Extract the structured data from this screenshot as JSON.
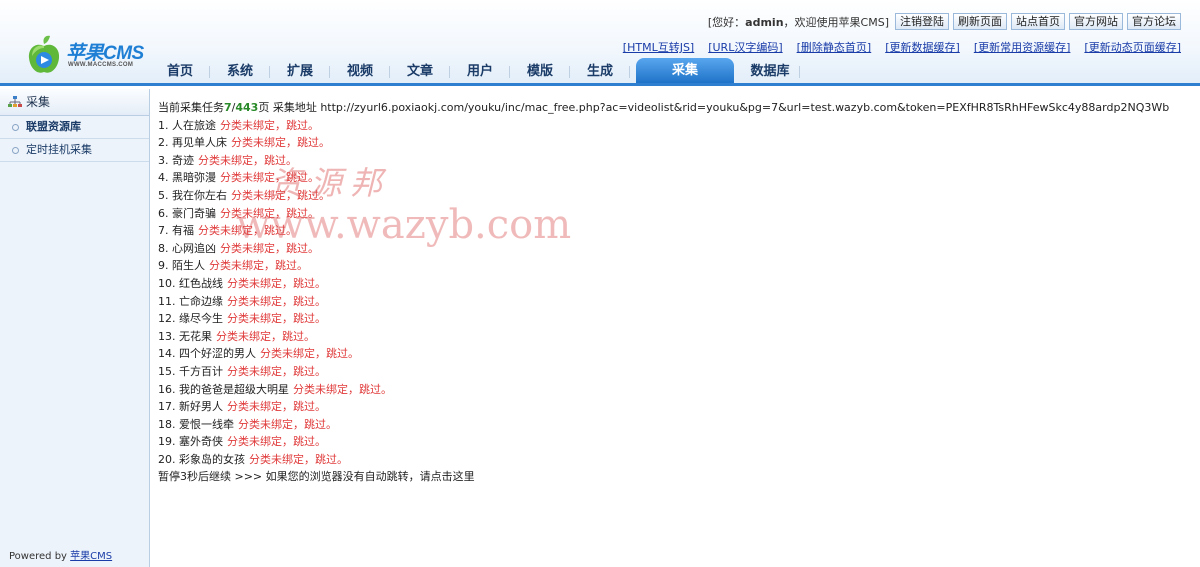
{
  "header": {
    "logo_text": "苹果CMS",
    "logo_sub": "WWW.MACCMS.COM",
    "welcome_prefix": "[您好：",
    "username": "admin",
    "welcome_suffix": "，欢迎使用苹果CMS]",
    "buttons": [
      "注销登陆",
      "刷新页面",
      "站点首页",
      "官方网站",
      "官方论坛"
    ],
    "quick_links": [
      "[HTML互转JS]",
      "[URL汉字编码]",
      "[删除静态首页]",
      "[更新数据缓存]",
      "[更新常用资源缓存]",
      "[更新动态页面缓存]"
    ],
    "nav": [
      "首页",
      "系统",
      "扩展",
      "视频",
      "文章",
      "用户",
      "模版",
      "生成",
      "采集",
      "数据库"
    ],
    "nav_active": "采集"
  },
  "sidebar": {
    "title": "采集",
    "items": [
      {
        "label": "联盟资源库",
        "bold": true
      },
      {
        "label": "定时挂机采集",
        "bold": false
      }
    ],
    "powered_prefix": "Powered by ",
    "powered_link": "苹果CMS"
  },
  "main": {
    "task_prefix": "当前采集任务",
    "task_current": "7",
    "task_sep": "/",
    "task_total": "443",
    "task_suffix": "页 采集地址 http://zyurl6.poxiaokj.com/youku/inc/mac_free.php?ac=videolist&rid=youku&pg=7&url=test.wazyb.com&token=PEXfHR8TsRhHFewSkc4y88ardp2NQ3Wb",
    "skip_text": "分类未绑定，跳过。",
    "items": [
      "1. 人在旅途",
      "2. 再见单人床",
      "3. 奇迹",
      "4. 黑暗弥漫",
      "5. 我在你左右",
      "6. 豪门奇骗",
      "7. 有福",
      "8. 心网追凶",
      "9. 陌生人",
      "10. 红色战线",
      "11. 亡命边缘",
      "12. 缘尽今生",
      "13. 无花果",
      "14. 四个好涩的男人",
      "15. 千方百计",
      "16. 我的爸爸是超级大明星",
      "17. 新好男人",
      "18. 爱恨一线牵",
      "19. 塞外奇侠",
      "20. 彩象岛的女孩"
    ],
    "footer_text": "暂停3秒后继续 >>> 如果您的浏览器没有自动跳转，请点击这里"
  },
  "watermark": {
    "line1": "资源邦",
    "line2": "www.wazyb.com"
  },
  "colors": {
    "accent": "#2f7fd0",
    "skip": "#e03b3b",
    "link": "#1a3ca8"
  }
}
